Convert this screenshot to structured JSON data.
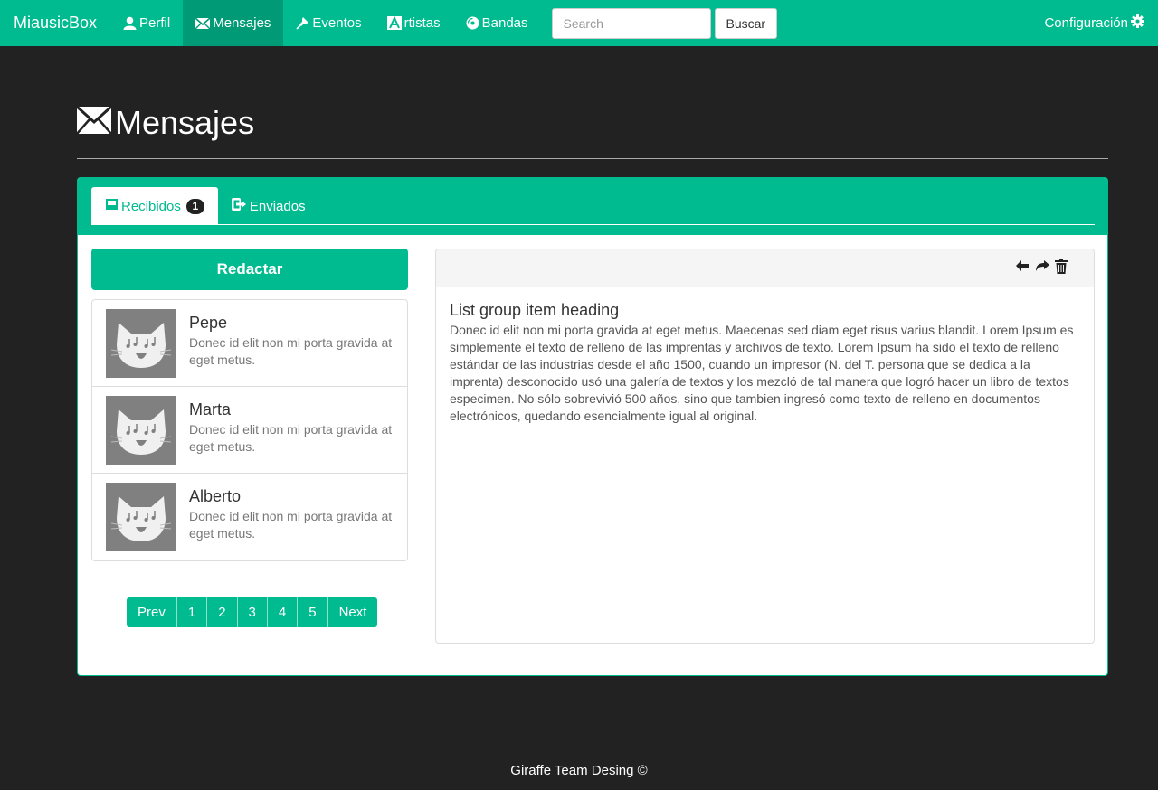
{
  "navbar": {
    "brand": "MiausicBox",
    "items": [
      {
        "label": "Perfil",
        "icon": "user-icon"
      },
      {
        "label": "Mensajes",
        "icon": "envelope-icon",
        "active": true
      },
      {
        "label": "Eventos",
        "icon": "pushpin-icon"
      },
      {
        "label": "rtistas",
        "icon": "font-icon"
      },
      {
        "label": "Bandas",
        "icon": "cd-icon"
      }
    ],
    "search_placeholder": "Search",
    "search_button": "Buscar",
    "config_label": "Configuración"
  },
  "page": {
    "title": "Mensajes"
  },
  "tabs": [
    {
      "label": "Recibidos",
      "badge": "1",
      "active": true
    },
    {
      "label": "Enviados"
    }
  ],
  "compose_label": "Redactar",
  "messages": [
    {
      "name": "Pepe",
      "preview": "Donec id elit non mi porta gravida at eget metus."
    },
    {
      "name": "Marta",
      "preview": "Donec id elit non mi porta gravida at eget metus."
    },
    {
      "name": "Alberto",
      "preview": "Donec id elit non mi porta gravida at eget metus."
    }
  ],
  "pagination": [
    "Prev",
    "1",
    "2",
    "3",
    "4",
    "5",
    "Next"
  ],
  "reader": {
    "heading": "List group item heading",
    "body": "Donec id elit non mi porta gravida at eget metus. Maecenas sed diam eget risus varius blandit. Lorem Ipsum es simplemente el texto de relleno de las imprentas y archivos de texto. Lorem Ipsum ha sido el texto de relleno estándar de las industrias desde el año 1500, cuando un impresor (N. del T. persona que se dedica a la imprenta) desconocido usó una galería de textos y los mezcló de tal manera que logró hacer un libro de textos especimen. No sólo sobrevivió 500 años, sino que tambien ingresó como texto de relleno en documentos electrónicos, quedando esencialmente igual al original."
  },
  "footer": "Giraffe Team Desing ©",
  "colors": {
    "accent": "#00bb8f",
    "accent_dark": "#009a76",
    "background": "#222222"
  }
}
